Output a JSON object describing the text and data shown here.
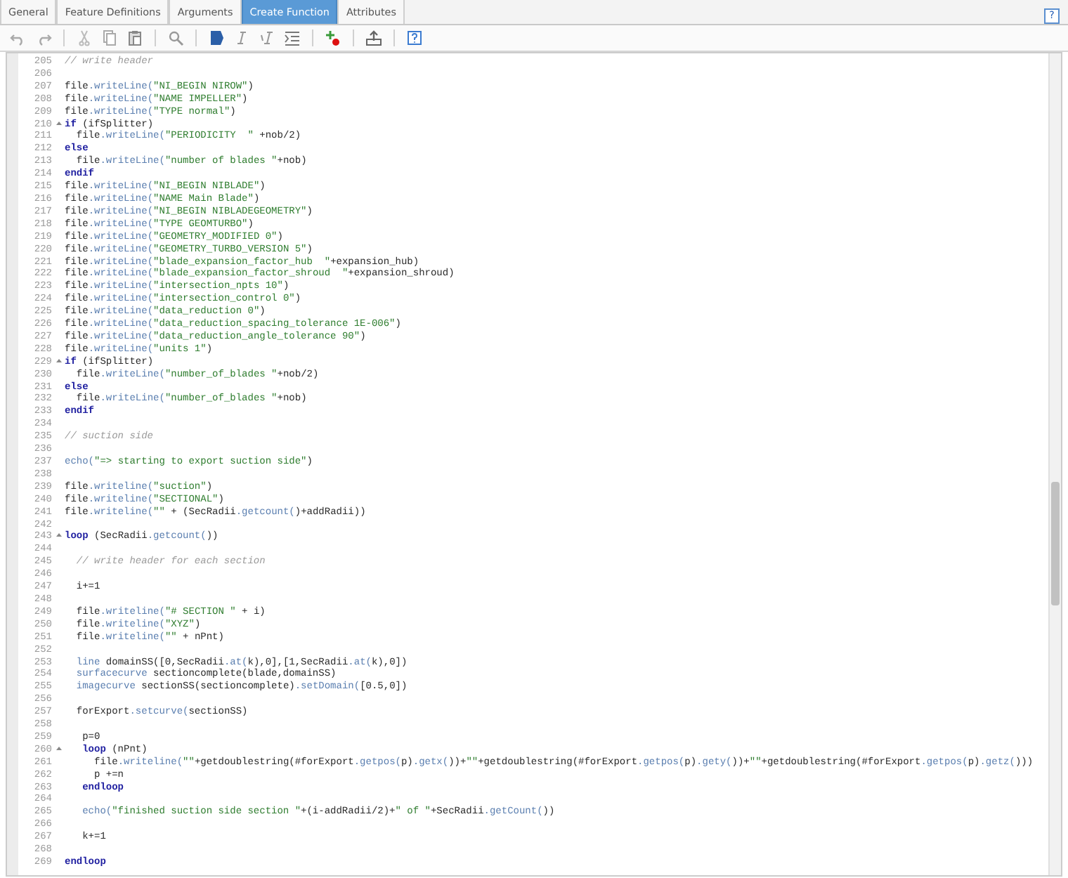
{
  "tabs": [
    {
      "label": "General",
      "selected": false
    },
    {
      "label": "Feature Definitions",
      "selected": false
    },
    {
      "label": "Arguments",
      "selected": false
    },
    {
      "label": "Create Function",
      "selected": true
    },
    {
      "label": "Attributes",
      "selected": false
    }
  ],
  "help_button": "?",
  "editor": {
    "lines": [
      {
        "number": "205",
        "fold": false,
        "tokens": [
          {
            "kind": "comment",
            "text": "// write header"
          }
        ]
      },
      {
        "number": "206",
        "fold": false
      },
      {
        "number": "207",
        "fold": false,
        "tokens": [
          {
            "kind": "plain",
            "text": "file"
          },
          {
            "kind": "method",
            "text": ".writeLine("
          },
          {
            "kind": "string",
            "text": "\"NI_BEGIN NIROW\""
          },
          {
            "kind": "plain",
            "text": ")"
          }
        ]
      },
      {
        "number": "208",
        "fold": false,
        "tokens": [
          {
            "kind": "plain",
            "text": "file"
          },
          {
            "kind": "method",
            "text": ".writeLine("
          },
          {
            "kind": "string",
            "text": "\"NAME IMPELLER\""
          },
          {
            "kind": "plain",
            "text": ")"
          }
        ]
      },
      {
        "number": "209",
        "fold": false,
        "tokens": [
          {
            "kind": "plain",
            "text": "file"
          },
          {
            "kind": "method",
            "text": ".writeLine("
          },
          {
            "kind": "string",
            "text": "\"TYPE normal\""
          },
          {
            "kind": "plain",
            "text": ")"
          }
        ]
      },
      {
        "number": "210",
        "fold": true,
        "tokens": [
          {
            "kind": "keyword",
            "text": "if"
          },
          {
            "kind": "plain",
            "text": " (ifSplitter)"
          }
        ]
      },
      {
        "number": "211",
        "fold": false,
        "tokens": [
          {
            "kind": "plain",
            "text": "  file"
          },
          {
            "kind": "method",
            "text": ".writeLine("
          },
          {
            "kind": "string",
            "text": "\"PERIODICITY  \""
          },
          {
            "kind": "plain",
            "text": " +nob/2)"
          }
        ]
      },
      {
        "number": "212",
        "fold": false,
        "tokens": [
          {
            "kind": "keyword",
            "text": "else"
          }
        ]
      },
      {
        "number": "213",
        "fold": false,
        "tokens": [
          {
            "kind": "plain",
            "text": "  file"
          },
          {
            "kind": "method",
            "text": ".writeLine("
          },
          {
            "kind": "string",
            "text": "\"number of blades \""
          },
          {
            "kind": "plain",
            "text": "+nob)"
          }
        ]
      },
      {
        "number": "214",
        "fold": false,
        "tokens": [
          {
            "kind": "keyword",
            "text": "endif"
          }
        ]
      },
      {
        "number": "215",
        "fold": false,
        "tokens": [
          {
            "kind": "plain",
            "text": "file"
          },
          {
            "kind": "method",
            "text": ".writeLine("
          },
          {
            "kind": "string",
            "text": "\"NI_BEGIN NIBLADE\""
          },
          {
            "kind": "plain",
            "text": ")"
          }
        ]
      },
      {
        "number": "216",
        "fold": false,
        "tokens": [
          {
            "kind": "plain",
            "text": "file"
          },
          {
            "kind": "method",
            "text": ".writeLine("
          },
          {
            "kind": "string",
            "text": "\"NAME Main Blade\""
          },
          {
            "kind": "plain",
            "text": ")"
          }
        ]
      },
      {
        "number": "217",
        "fold": false,
        "tokens": [
          {
            "kind": "plain",
            "text": "file"
          },
          {
            "kind": "method",
            "text": ".writeLine("
          },
          {
            "kind": "string",
            "text": "\"NI_BEGIN NIBLADEGEOMETRY\""
          },
          {
            "kind": "plain",
            "text": ")"
          }
        ]
      },
      {
        "number": "218",
        "fold": false,
        "tokens": [
          {
            "kind": "plain",
            "text": "file"
          },
          {
            "kind": "method",
            "text": ".writeLine("
          },
          {
            "kind": "string",
            "text": "\"TYPE GEOMTURBO\""
          },
          {
            "kind": "plain",
            "text": ")"
          }
        ]
      },
      {
        "number": "219",
        "fold": false,
        "tokens": [
          {
            "kind": "plain",
            "text": "file"
          },
          {
            "kind": "method",
            "text": ".writeLine("
          },
          {
            "kind": "string",
            "text": "\"GEOMETRY_MODIFIED 0\""
          },
          {
            "kind": "plain",
            "text": ")"
          }
        ]
      },
      {
        "number": "220",
        "fold": false,
        "tokens": [
          {
            "kind": "plain",
            "text": "file"
          },
          {
            "kind": "method",
            "text": ".writeLine("
          },
          {
            "kind": "string",
            "text": "\"GEOMETRY_TURBO_VERSION 5\""
          },
          {
            "kind": "plain",
            "text": ")"
          }
        ]
      },
      {
        "number": "221",
        "fold": false,
        "tokens": [
          {
            "kind": "plain",
            "text": "file"
          },
          {
            "kind": "method",
            "text": ".writeLine("
          },
          {
            "kind": "string",
            "text": "\"blade_expansion_factor_hub  \""
          },
          {
            "kind": "plain",
            "text": "+expansion_hub)"
          }
        ]
      },
      {
        "number": "222",
        "fold": false,
        "tokens": [
          {
            "kind": "plain",
            "text": "file"
          },
          {
            "kind": "method",
            "text": ".writeLine("
          },
          {
            "kind": "string",
            "text": "\"blade_expansion_factor_shroud  \""
          },
          {
            "kind": "plain",
            "text": "+expansion_shroud)"
          }
        ]
      },
      {
        "number": "223",
        "fold": false,
        "tokens": [
          {
            "kind": "plain",
            "text": "file"
          },
          {
            "kind": "method",
            "text": ".writeLine("
          },
          {
            "kind": "string",
            "text": "\"intersection_npts 10\""
          },
          {
            "kind": "plain",
            "text": ")"
          }
        ]
      },
      {
        "number": "224",
        "fold": false,
        "tokens": [
          {
            "kind": "plain",
            "text": "file"
          },
          {
            "kind": "method",
            "text": ".writeLine("
          },
          {
            "kind": "string",
            "text": "\"intersection_control 0\""
          },
          {
            "kind": "plain",
            "text": ")"
          }
        ]
      },
      {
        "number": "225",
        "fold": false,
        "tokens": [
          {
            "kind": "plain",
            "text": "file"
          },
          {
            "kind": "method",
            "text": ".writeLine("
          },
          {
            "kind": "string",
            "text": "\"data_reduction 0\""
          },
          {
            "kind": "plain",
            "text": ")"
          }
        ]
      },
      {
        "number": "226",
        "fold": false,
        "tokens": [
          {
            "kind": "plain",
            "text": "file"
          },
          {
            "kind": "method",
            "text": ".writeLine("
          },
          {
            "kind": "string",
            "text": "\"data_reduction_spacing_tolerance 1E-006\""
          },
          {
            "kind": "plain",
            "text": ")"
          }
        ]
      },
      {
        "number": "227",
        "fold": false,
        "tokens": [
          {
            "kind": "plain",
            "text": "file"
          },
          {
            "kind": "method",
            "text": ".writeLine("
          },
          {
            "kind": "string",
            "text": "\"data_reduction_angle_tolerance 90\""
          },
          {
            "kind": "plain",
            "text": ")"
          }
        ]
      },
      {
        "number": "228",
        "fold": false,
        "tokens": [
          {
            "kind": "plain",
            "text": "file"
          },
          {
            "kind": "method",
            "text": ".writeLine("
          },
          {
            "kind": "string",
            "text": "\"units 1\""
          },
          {
            "kind": "plain",
            "text": ")"
          }
        ]
      },
      {
        "number": "229",
        "fold": true,
        "tokens": [
          {
            "kind": "keyword",
            "text": "if"
          },
          {
            "kind": "plain",
            "text": " (ifSplitter)"
          }
        ]
      },
      {
        "number": "230",
        "fold": false,
        "tokens": [
          {
            "kind": "plain",
            "text": "  file"
          },
          {
            "kind": "method",
            "text": ".writeLine("
          },
          {
            "kind": "string",
            "text": "\"number_of_blades \""
          },
          {
            "kind": "plain",
            "text": "+nob/2)"
          }
        ]
      },
      {
        "number": "231",
        "fold": false,
        "tokens": [
          {
            "kind": "keyword",
            "text": "else"
          }
        ]
      },
      {
        "number": "232",
        "fold": false,
        "tokens": [
          {
            "kind": "plain",
            "text": "  file"
          },
          {
            "kind": "method",
            "text": ".writeLine("
          },
          {
            "kind": "string",
            "text": "\"number_of_blades \""
          },
          {
            "kind": "plain",
            "text": "+nob)"
          }
        ]
      },
      {
        "number": "233",
        "fold": false,
        "tokens": [
          {
            "kind": "keyword",
            "text": "endif"
          }
        ]
      },
      {
        "number": "234",
        "fold": false
      },
      {
        "number": "235",
        "fold": false,
        "tokens": [
          {
            "kind": "comment",
            "text": "// suction side"
          }
        ]
      },
      {
        "number": "236",
        "fold": false
      },
      {
        "number": "237",
        "fold": false,
        "tokens": [
          {
            "kind": "method",
            "text": "echo("
          },
          {
            "kind": "string",
            "text": "\"=> starting to export suction side\""
          },
          {
            "kind": "plain",
            "text": ")"
          }
        ]
      },
      {
        "number": "238",
        "fold": false
      },
      {
        "number": "239",
        "fold": false,
        "tokens": [
          {
            "kind": "plain",
            "text": "file"
          },
          {
            "kind": "method",
            "text": ".writeline("
          },
          {
            "kind": "string",
            "text": "\"suction\""
          },
          {
            "kind": "plain",
            "text": ")"
          }
        ]
      },
      {
        "number": "240",
        "fold": false,
        "tokens": [
          {
            "kind": "plain",
            "text": "file"
          },
          {
            "kind": "method",
            "text": ".writeline("
          },
          {
            "kind": "string",
            "text": "\"SECTIONAL\""
          },
          {
            "kind": "plain",
            "text": ")"
          }
        ]
      },
      {
        "number": "241",
        "fold": false,
        "tokens": [
          {
            "kind": "plain",
            "text": "file"
          },
          {
            "kind": "method",
            "text": ".writeline("
          },
          {
            "kind": "string",
            "text": "\"\""
          },
          {
            "kind": "plain",
            "text": " + (SecRadii"
          },
          {
            "kind": "method",
            "text": ".getcount("
          },
          {
            "kind": "plain",
            "text": ")+addRadii))"
          }
        ]
      },
      {
        "number": "242",
        "fold": false
      },
      {
        "number": "243",
        "fold": true,
        "tokens": [
          {
            "kind": "keyword",
            "text": "loop"
          },
          {
            "kind": "plain",
            "text": " (SecRadii"
          },
          {
            "kind": "method",
            "text": ".getcount("
          },
          {
            "kind": "plain",
            "text": "))"
          }
        ]
      },
      {
        "number": "244",
        "fold": false
      },
      {
        "number": "245",
        "fold": false,
        "tokens": [
          {
            "kind": "comment",
            "text": "  // write header for each section"
          }
        ]
      },
      {
        "number": "246",
        "fold": false
      },
      {
        "number": "247",
        "fold": false,
        "tokens": [
          {
            "kind": "plain",
            "text": "  i+=1"
          }
        ]
      },
      {
        "number": "248",
        "fold": false
      },
      {
        "number": "249",
        "fold": false,
        "tokens": [
          {
            "kind": "plain",
            "text": "  file"
          },
          {
            "kind": "method",
            "text": ".writeline("
          },
          {
            "kind": "string",
            "text": "\"# SECTION \""
          },
          {
            "kind": "plain",
            "text": " + i)"
          }
        ]
      },
      {
        "number": "250",
        "fold": false,
        "tokens": [
          {
            "kind": "plain",
            "text": "  file"
          },
          {
            "kind": "method",
            "text": ".writeline("
          },
          {
            "kind": "string",
            "text": "\"XYZ\""
          },
          {
            "kind": "plain",
            "text": ")"
          }
        ]
      },
      {
        "number": "251",
        "fold": false,
        "tokens": [
          {
            "kind": "plain",
            "text": "  file"
          },
          {
            "kind": "method",
            "text": ".writeline("
          },
          {
            "kind": "string",
            "text": "\"\""
          },
          {
            "kind": "plain",
            "text": " + nPnt)"
          }
        ]
      },
      {
        "number": "252",
        "fold": false
      },
      {
        "number": "253",
        "fold": false,
        "tokens": [
          {
            "kind": "method",
            "text": "  line"
          },
          {
            "kind": "plain",
            "text": " domainSS([0,SecRadii"
          },
          {
            "kind": "method",
            "text": ".at("
          },
          {
            "kind": "plain",
            "text": "k),0],[1,SecRadii"
          },
          {
            "kind": "method",
            "text": ".at("
          },
          {
            "kind": "plain",
            "text": "k),0])"
          }
        ]
      },
      {
        "number": "254",
        "fold": false,
        "tokens": [
          {
            "kind": "method",
            "text": "  surfacecurve"
          },
          {
            "kind": "plain",
            "text": " sectioncomplete(blade,domainSS)"
          }
        ]
      },
      {
        "number": "255",
        "fold": false,
        "tokens": [
          {
            "kind": "method",
            "text": "  imagecurve"
          },
          {
            "kind": "plain",
            "text": " sectionSS(sectioncomplete)"
          },
          {
            "kind": "method",
            "text": ".setDomain("
          },
          {
            "kind": "plain",
            "text": "[0.5,0])"
          }
        ]
      },
      {
        "number": "256",
        "fold": false
      },
      {
        "number": "257",
        "fold": false,
        "tokens": [
          {
            "kind": "plain",
            "text": "  forExport"
          },
          {
            "kind": "method",
            "text": ".setcurve("
          },
          {
            "kind": "plain",
            "text": "sectionSS)"
          }
        ]
      },
      {
        "number": "258",
        "fold": false
      },
      {
        "number": "259",
        "fold": false,
        "tokens": [
          {
            "kind": "plain",
            "text": "   p=0"
          }
        ]
      },
      {
        "number": "260",
        "fold": true,
        "tokens": [
          {
            "kind": "keyword",
            "text": "   loop"
          },
          {
            "kind": "plain",
            "text": " (nPnt)"
          }
        ]
      },
      {
        "number": "261",
        "fold": false,
        "tokens": [
          {
            "kind": "plain",
            "text": "     file"
          },
          {
            "kind": "method",
            "text": ".writeline("
          },
          {
            "kind": "string",
            "text": "\"\""
          },
          {
            "kind": "plain",
            "text": "+getdoublestring(#forExport"
          },
          {
            "kind": "method",
            "text": ".getpos("
          },
          {
            "kind": "plain",
            "text": "p)"
          },
          {
            "kind": "method",
            "text": ".getx("
          },
          {
            "kind": "plain",
            "text": "))+"
          },
          {
            "kind": "string",
            "text": "\"\""
          },
          {
            "kind": "plain",
            "text": "+getdoublestring(#forExport"
          },
          {
            "kind": "method",
            "text": ".getpos("
          },
          {
            "kind": "plain",
            "text": "p)"
          },
          {
            "kind": "method",
            "text": ".gety("
          },
          {
            "kind": "plain",
            "text": "))+"
          },
          {
            "kind": "string",
            "text": "\"\""
          },
          {
            "kind": "plain",
            "text": "+getdoublestring(#forExport"
          },
          {
            "kind": "method",
            "text": ".getpos("
          },
          {
            "kind": "plain",
            "text": "p)"
          },
          {
            "kind": "method",
            "text": ".getz("
          },
          {
            "kind": "plain",
            "text": ")))"
          }
        ]
      },
      {
        "number": "262",
        "fold": false,
        "tokens": [
          {
            "kind": "plain",
            "text": "     p +=n"
          }
        ]
      },
      {
        "number": "263",
        "fold": false,
        "tokens": [
          {
            "kind": "keyword",
            "text": "   endloop"
          }
        ]
      },
      {
        "number": "264",
        "fold": false
      },
      {
        "number": "265",
        "fold": false,
        "tokens": [
          {
            "kind": "method",
            "text": "   echo("
          },
          {
            "kind": "string",
            "text": "\"finished suction side section \""
          },
          {
            "kind": "plain",
            "text": "+(i-addRadii/2)+"
          },
          {
            "kind": "string",
            "text": "\" of \""
          },
          {
            "kind": "plain",
            "text": "+SecRadii"
          },
          {
            "kind": "method",
            "text": ".getCount("
          },
          {
            "kind": "plain",
            "text": "))"
          }
        ]
      },
      {
        "number": "266",
        "fold": false
      },
      {
        "number": "267",
        "fold": false,
        "tokens": [
          {
            "kind": "plain",
            "text": "   k+=1"
          }
        ]
      },
      {
        "number": "268",
        "fold": false
      },
      {
        "number": "269",
        "fold": false,
        "tokens": [
          {
            "kind": "keyword",
            "text": "endloop"
          }
        ]
      }
    ]
  }
}
